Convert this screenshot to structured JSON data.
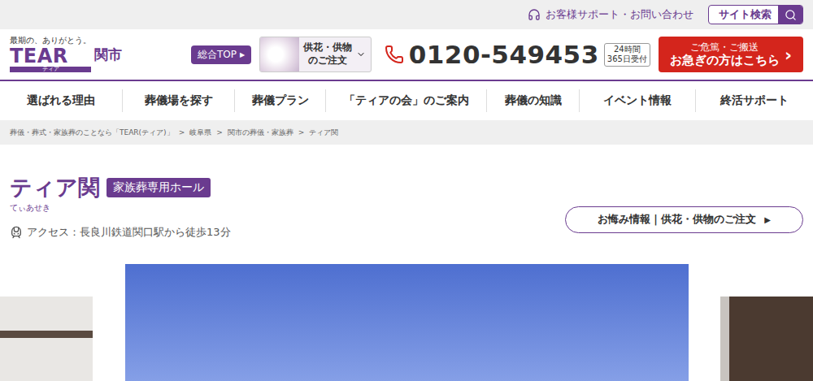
{
  "topbar": {
    "support": "お客様サポート・お問い合わせ",
    "search": "サイト検索"
  },
  "header": {
    "tagline": "最期の、ありがとう。",
    "logo": "TEAR",
    "logo_sub": "ティア",
    "city": "関市",
    "top_link": "総合TOP",
    "top_link_arrow": "▶",
    "flower_order": [
      "供花・供物",
      "のご注文"
    ],
    "phone": "0120-549453",
    "hours": [
      "24時間",
      "365日受付"
    ],
    "emergency": [
      "ご危篤・ご搬送",
      "お急ぎの方はこちら"
    ],
    "emergency_arrow": "›"
  },
  "nav": [
    {
      "label": "選ばれる理由"
    },
    {
      "label": "葬儀場を探す"
    },
    {
      "label": "葬儀プラン"
    },
    {
      "label": "「ティアの会」のご案内"
    },
    {
      "label": "葬儀の知識"
    },
    {
      "label": "イベント情報"
    },
    {
      "label": "終活サポート"
    }
  ],
  "breadcrumb": {
    "separator": ">",
    "items": [
      "葬儀・葬式・家族葬のことなら「TEAR(ティア)」",
      "岐阜県",
      "関市の葬儀・家族葬",
      "ティア関"
    ]
  },
  "hall": {
    "name": "ティア関",
    "badge": "家族葬専用ホール",
    "reading": "てぃあせき",
    "access": "アクセス：長良川鉄道関口駅から徒歩13分",
    "condolence_button": "お悔み情報｜供花・供物のご注文",
    "condolence_arrow": "▶"
  },
  "carousel": {
    "slides": [
      {
        "selected": false
      },
      {
        "selected": true
      },
      {
        "selected": false
      }
    ]
  }
}
